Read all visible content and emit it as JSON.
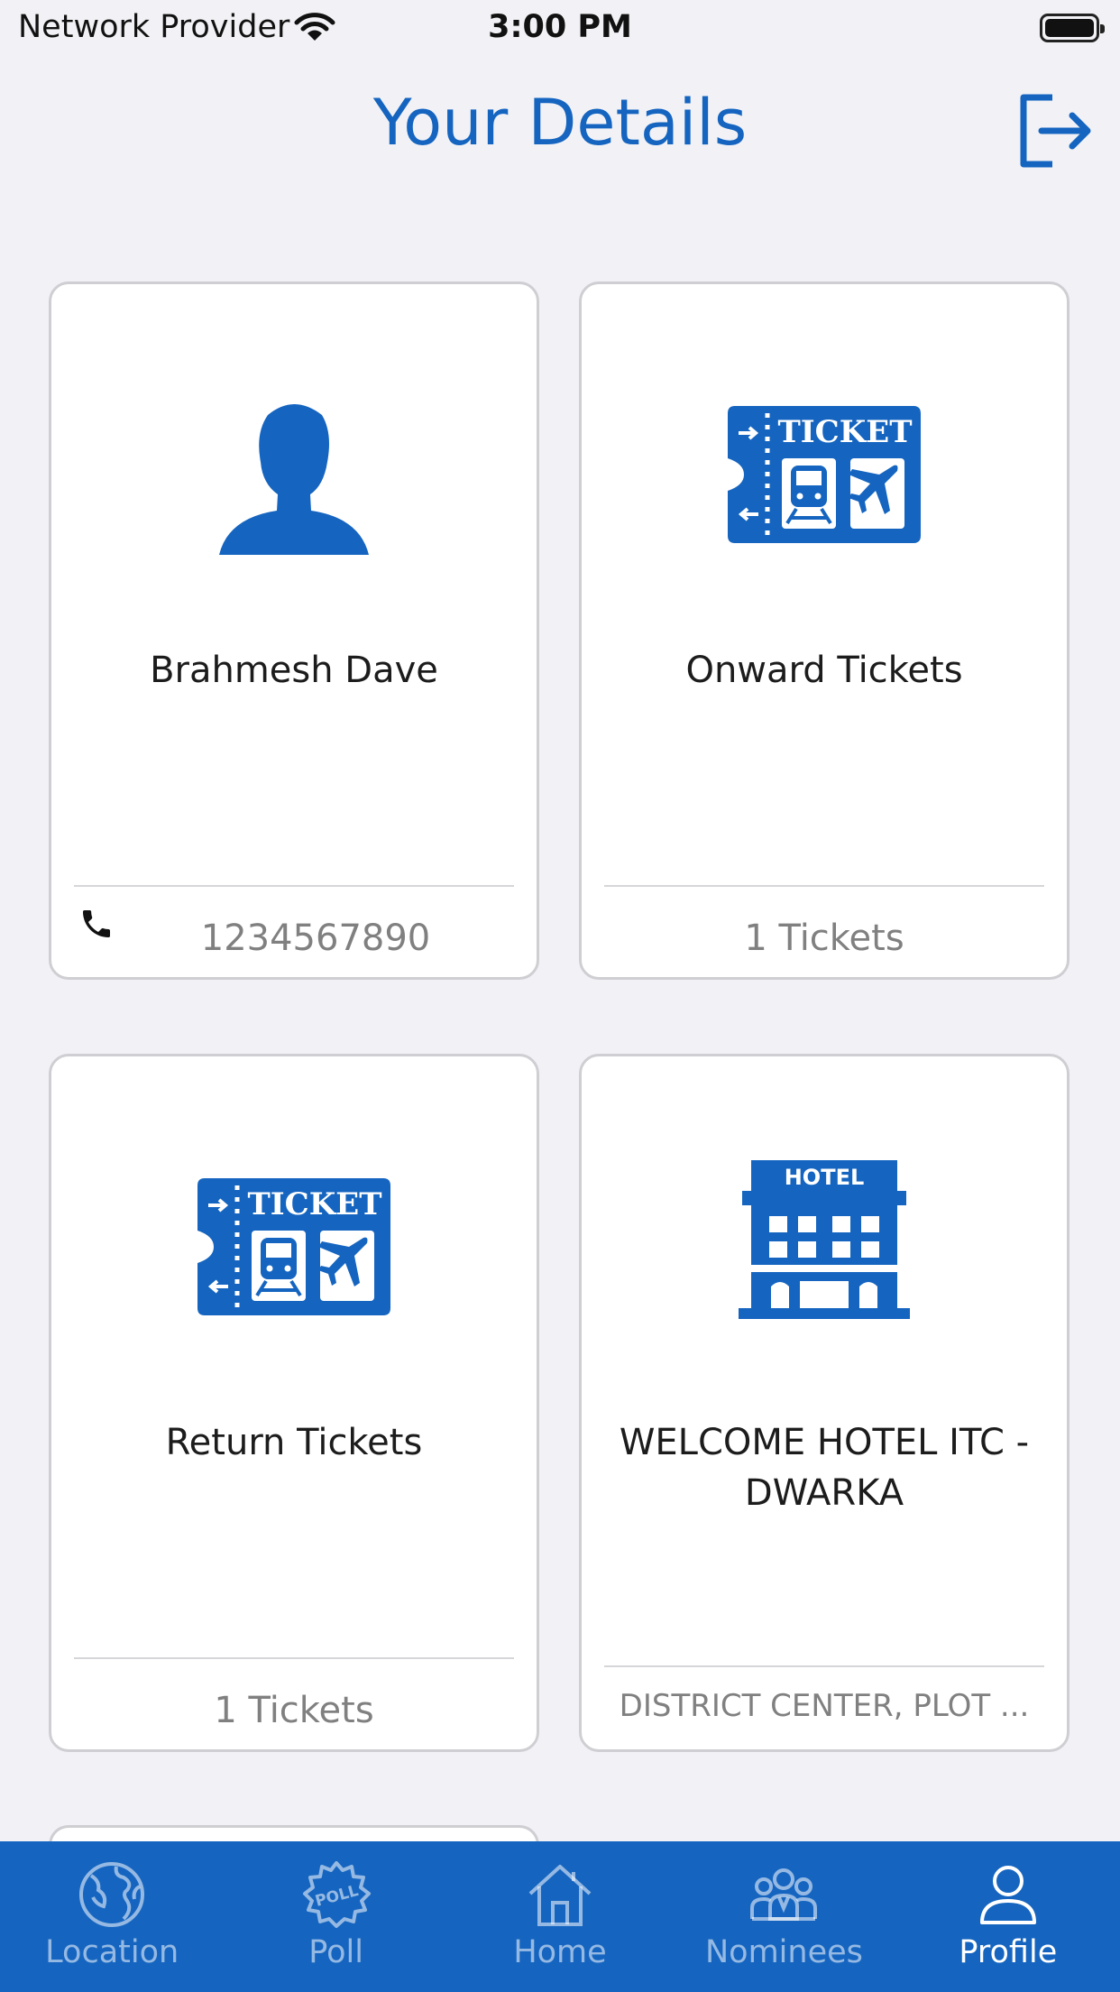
{
  "status_bar": {
    "carrier": "Network Provider",
    "time": "3:00 PM"
  },
  "header": {
    "title": "Your Details",
    "logout_icon": "logout-icon"
  },
  "cards": [
    {
      "icon": "person-icon",
      "title": "Brahmesh Dave",
      "footer": "1234567890",
      "footer_icon": "phone-icon"
    },
    {
      "icon": "ticket-icon",
      "icon_text": "TICKET",
      "title": "Onward Tickets",
      "footer": "1 Tickets"
    },
    {
      "icon": "ticket-icon",
      "icon_text": "TICKET",
      "title": "Return Tickets",
      "footer": "1 Tickets"
    },
    {
      "icon": "hotel-icon",
      "icon_text": "HOTEL",
      "title": "WELCOME HOTEL ITC - DWARKA",
      "footer": "DISTRICT CENTER, PLOT ..."
    }
  ],
  "tab_bar": {
    "tabs": [
      {
        "label": "Location",
        "icon": "globe-icon",
        "active": false
      },
      {
        "label": "Poll",
        "icon": "poll-badge-icon",
        "icon_text": "POLL",
        "active": false
      },
      {
        "label": "Home",
        "icon": "home-icon",
        "active": false
      },
      {
        "label": "Nominees",
        "icon": "group-icon",
        "active": false
      },
      {
        "label": "Profile",
        "icon": "person-outline-icon",
        "active": true
      }
    ]
  },
  "colors": {
    "accent": "#1565c0",
    "background": "#f2f2f6",
    "card_border": "#cfcfd3",
    "footer_text": "#808080"
  }
}
